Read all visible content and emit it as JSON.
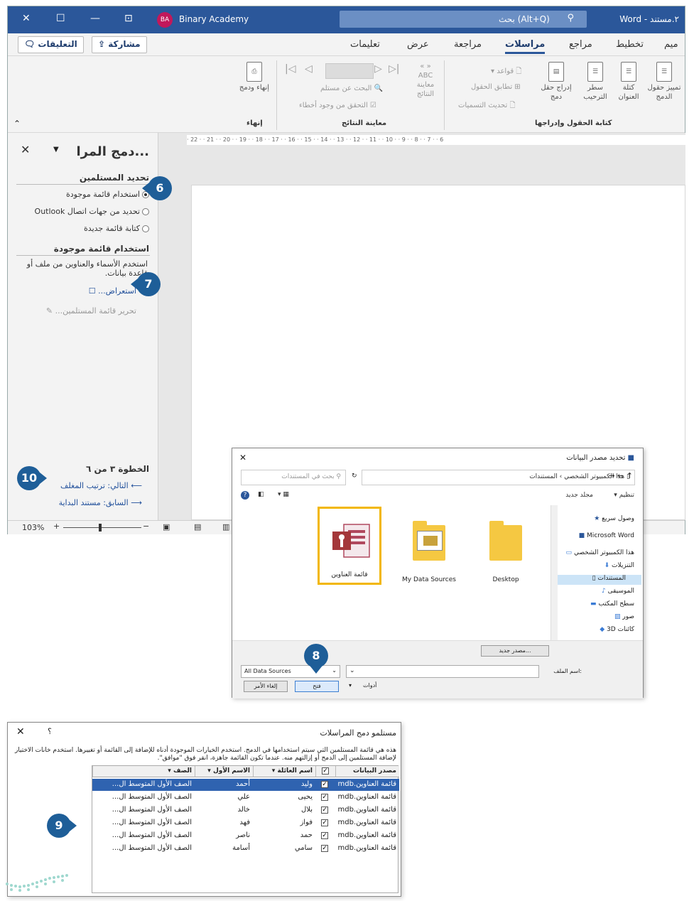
{
  "titlebar": {
    "account_initials": "BA",
    "account_name": "Binary Academy",
    "search_label": "بحث (Alt+Q)",
    "doc_name": "Word - ٢.مستند"
  },
  "ribbon_tabs": {
    "tabs": [
      "ميم",
      "تخطيط",
      "مراجع",
      "مراسلات",
      "مراجعة",
      "عرض",
      "تعليمات"
    ],
    "share": "مشاركة",
    "comments": "التعليقات"
  },
  "ribbon": {
    "finish": {
      "btn": "إنهاء ودمج",
      "group": "إنهاء"
    },
    "preview": {
      "find": "البحث عن مستلم",
      "check": "التحقق من وجود أخطاء",
      "preview_btn": "معاينة النتائج",
      "group": "معاينة النتائج"
    },
    "write": {
      "highlight": "تمييز حقول الدمج",
      "address": "كتلة العنوان",
      "greeting": "سطر الترحيب",
      "insert": "إدراج حقل دمج",
      "rules": "قواعد",
      "match": "تطابق الحقول",
      "update": "تحديث التسميات",
      "group": "كتابة الحقول وإدراجها"
    }
  },
  "ruler": "· 22 · · 21 · · 20 · · 19 · · 18 · · 17 · · 16 · · 15 · · 14 · · 13 · · 12 · · 11 · · 10 · · 9 · · 8 · · 7 · · 6",
  "mail_merge_pane": {
    "title": "دمج المرا...",
    "section1": "تحديد المستلمين",
    "options": [
      "استخدام قائمة موجودة",
      "تحديد من جهات اتصال Outlook",
      "كتابة قائمة جديدة"
    ],
    "section2": "استخدام قائمة موجودة",
    "description": "استخدم الأسماء والعناوين من ملف أو قاعدة بيانات.",
    "browse": "استعراض...",
    "edit_list": "تحرير قائمة المستلمين...",
    "step": "الخطوة ٣ من ٦",
    "next": "التالي: ترتيب المغلف",
    "prev": "السابق: مستند البداية"
  },
  "statusbar": {
    "zoom": "103%"
  },
  "badges": {
    "b6": "6",
    "b7": "7",
    "b8": "8",
    "b9": "9",
    "b10": "10"
  },
  "ds_dialog": {
    "title": "تحديد مصدر البيانات",
    "path": "هذا الكمبيوتر الشخصي › المستندات",
    "search": "بحث في المستندات",
    "organize": "تنظيم",
    "new_folder": "مجلد جديد",
    "nav": [
      "وصول سريع",
      "Microsoft Word",
      "هذا الكمبيوتر الشخصي",
      "التنزيلات",
      "المستندات",
      "الموسيقى",
      "سطح المكتب",
      "صور",
      "كائنات 3D"
    ],
    "files": [
      "قائمة العناوين",
      "My Data Sources",
      "Desktop"
    ],
    "new_source": "مصدر جديد...",
    "filename_label": "اسم الملف:",
    "filetype": "All Data Sources",
    "tools": "أدوات",
    "open": "فتح",
    "cancel": "إلغاء الأمر"
  },
  "recipients_dialog": {
    "title": "مستلمو دمج المراسلات",
    "help": "؟",
    "description": "هذه هي قائمة المستلمين التي سيتم استخدامها في الدمج. استخدم الخيارات الموجودة أدناه للإضافة إلى القائمة أو تغييرها. استخدم خانات الاختيار لإضافة المستلمين إلى الدمج أو إزالتهم منه. عندما تكون القائمة جاهزة، انقر فوق \"موافق\".",
    "columns": [
      "مصدر البيانات",
      "",
      "اسم العائلة",
      "الاسم الأول",
      "الصف"
    ],
    "rows": [
      [
        "قائمة العناوين.mdb",
        "وليد",
        "أحمد",
        "الصف الأول المتوسط ال..."
      ],
      [
        "قائمة العناوين.mdb",
        "يحيى",
        "علي",
        "الصف الأول المتوسط ال..."
      ],
      [
        "قائمة العناوين.mdb",
        "بلال",
        "خالد",
        "الصف الأول المتوسط ال..."
      ],
      [
        "قائمة العناوين.mdb",
        "فواز",
        "فهد",
        "الصف الأول المتوسط ال..."
      ],
      [
        "قائمة العناوين.mdb",
        "حمد",
        "ناصر",
        "الصف الأول المتوسط ال..."
      ],
      [
        "قائمة العناوين.mdb",
        "سامي",
        "أسامة",
        "الصف الأول المتوسط ال..."
      ]
    ]
  },
  "colors": {
    "word_blue": "#2b579a",
    "badge": "#1e5e98",
    "highlight": "#f2b705",
    "selection": "#2f63b0"
  }
}
